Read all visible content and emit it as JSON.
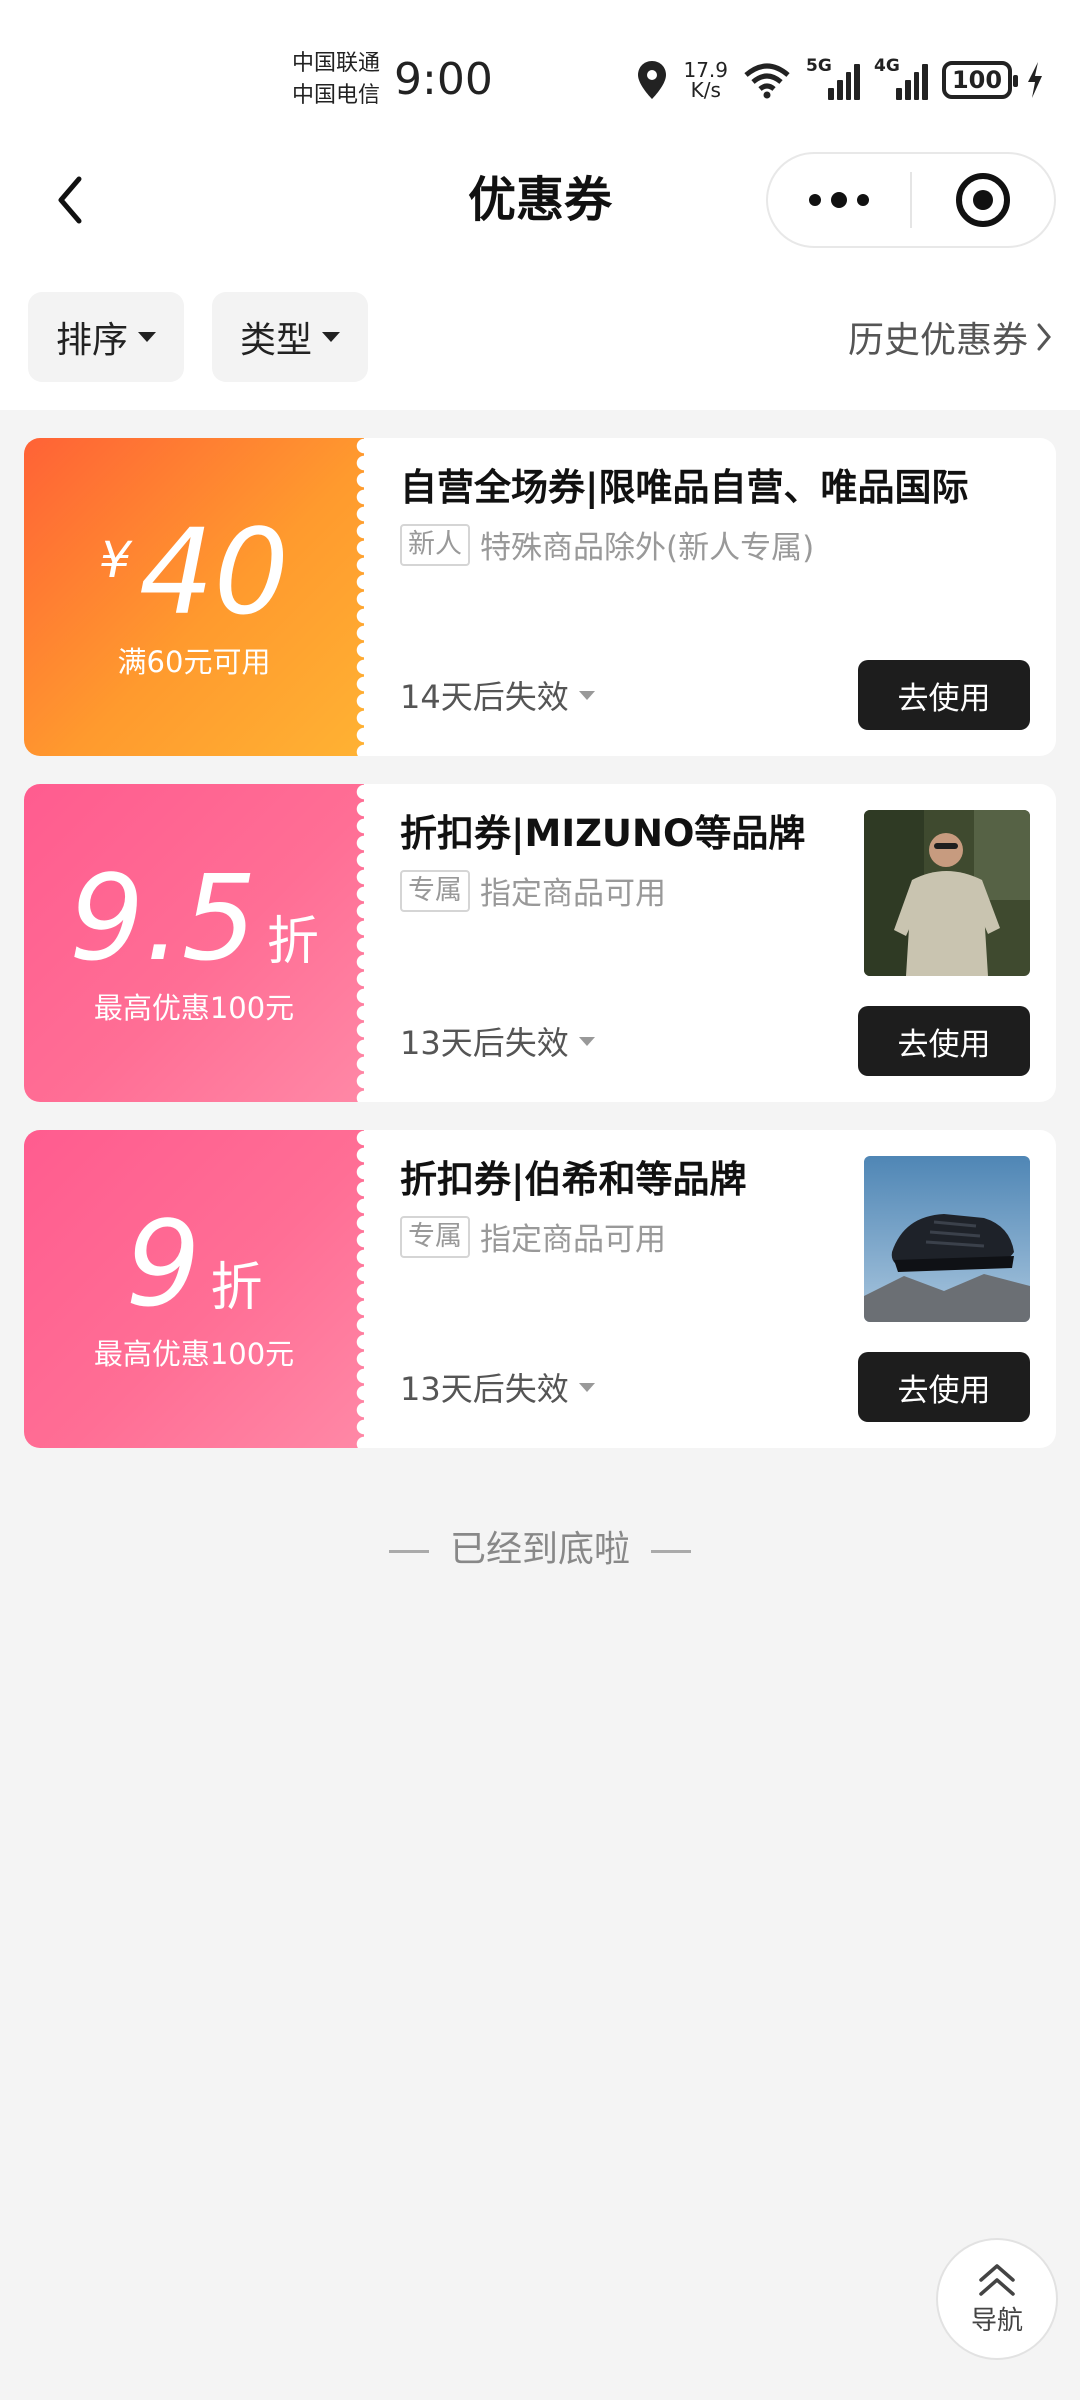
{
  "status_bar": {
    "carrier1": "中国联通",
    "carrier2": "中国电信",
    "time": "9:00",
    "speed_value": "17.9",
    "speed_unit": "K/s",
    "net1": "5G",
    "net2": "4G",
    "battery": "100"
  },
  "nav": {
    "title": "优惠券"
  },
  "filters": {
    "sort": "排序",
    "type": "类型",
    "history": "历史优惠券"
  },
  "coupons": [
    {
      "theme": "orange",
      "currency": "¥",
      "amount": "40",
      "unit": "",
      "condition": "满60元可用",
      "title": "自营全场券|限唯品自营、唯品国际",
      "badge": "新人",
      "desc": "特殊商品除外(新人专属)",
      "expire": "14天后失效",
      "button": "去使用"
    },
    {
      "theme": "pink",
      "currency": "",
      "amount": "9.5",
      "unit": "折",
      "condition": "最高优惠100元",
      "title": "折扣券|MIZUNO等品牌",
      "badge": "专属",
      "desc": "指定商品可用",
      "expire": "13天后失效",
      "button": "去使用",
      "image": "man-in-tshirt-photo"
    },
    {
      "theme": "pink",
      "currency": "",
      "amount": "9",
      "unit": "折",
      "condition": "最高优惠100元",
      "title": "折扣券|伯希和等品牌",
      "badge": "专属",
      "desc": "指定商品可用",
      "expire": "13天后失效",
      "button": "去使用",
      "image": "hiking-shoe-photo"
    }
  ],
  "footer": {
    "end_text": "已经到底啦"
  },
  "fab": {
    "label": "导航"
  }
}
